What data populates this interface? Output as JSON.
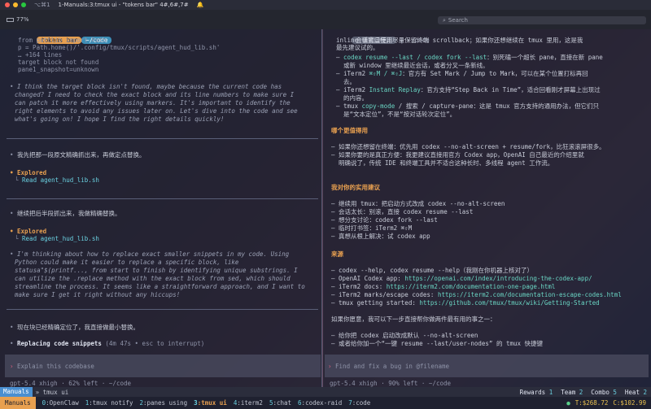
{
  "window": {
    "title": "1-Manuals:3:tmux ui - \"tokens bar\" 4#,6#,7#",
    "shortcut": "⌥⌘1"
  },
  "toolbar": {
    "battery": "77%",
    "search_placeholder": "Search"
  },
  "left": {
    "tab_label": "tokens bar",
    "path_label": "~/code",
    "code": [
      "from pathlib import Path",
      "p = Path.home()/'.config/tmux/scripts/agent_hud_lib.sh'",
      "… +164 lines",
      "target block not found",
      "pane1_snapshot=unknown"
    ],
    "thought1": [
      "I think the target block isn't found, maybe because the current code has",
      "changed? I need to check the exact block and its line numbers to make sure I",
      "can patch it more effectively using markers. It's important to identify the",
      "right elements to avoid any issues later on. Let's dive into the code and see",
      "what's going on! I hope I find the right details quickly!"
    ],
    "msg1": "我先把那一段原文精确抓出来，再做定点替换。",
    "explored1": "Explored",
    "read1": "Read agent_hud_lib.sh",
    "msg2": "继续把后半段抓出来，我做精确替换。",
    "explored2": "Explored",
    "read2": "Read agent_hud_lib.sh",
    "thought2": [
      "I'm thinking about how to replace exact smaller snippets in my code. Using",
      "Python could make it easier to replace a specific block, like",
      "statusa\"$(printf..., from start to finish by identifying unique substrings. I",
      "can utilize the .replace method with the exact block from sed, which should",
      "streamline the process. It seems like a straightforward approach, and I want to",
      "make sure I get it right without any hiccups!"
    ],
    "msg3": "现在块已经精确定位了，我直接做最小替换。",
    "working_label": "Replacing code snippets",
    "working_meta": "(4m 47s • esc to interrupt)",
    "input_placeholder": "Explain this codebase",
    "model_status": "gpt-5.4 xhigh · 62% left · ~/code"
  },
  "right": {
    "tab_label": "会话窗口使用",
    "path_label": "~/code",
    "top_lines": [
      "inline 模式运行，尽量保留终端 scrollback；如果你还想继续在 tmux 里用，这是我",
      "最先建议试的。"
    ],
    "items_a": [
      {
        "pre": "– ",
        "hl": "codex resume --last / codex fork --last",
        "post": "：别死磕一个超长 pane，直接在新 pane"
      },
      {
        "pre": "  或新 window 里继续最近会话，或者分叉一条新线。",
        "hl": "",
        "post": ""
      },
      {
        "pre": "– iTerm2 ",
        "hl": "⌘⇧M / ⌘⇧J",
        "post": "：官方有 Set Mark / Jump to Mark，可以在某个位置打标再回"
      },
      {
        "pre": "  去。",
        "hl": "",
        "post": ""
      },
      {
        "pre": "– iTerm2 ",
        "hl": "Instant Replay",
        "post": "：官方支持“Step Back in Time”，适合回看刚才屏幕上出现过"
      },
      {
        "pre": "  的内容。",
        "hl": "",
        "post": ""
      },
      {
        "pre": "– tmux ",
        "hl": "copy-mode",
        "post": " / 搜索 / capture-pane：这是 tmux 官方支持的通用办法，但它们只"
      },
      {
        "pre": "  是“文本定位”，不是“按对话轮次定位”。",
        "hl": "",
        "post": ""
      }
    ],
    "h_which": "哪个更值得用",
    "which": [
      "– 如果你还想留在终端：优先用 codex --no-alt-screen + resume/fork，比狂滚滚屏很多。",
      "– 如果你要的是真正方便：我更建议直接用官方 Codex app，OpenAI 自己最近的介绍里就",
      "  明确说了，传统 IDE 和终端工具并不适合这种长时、多线程 agent 工作流。"
    ],
    "h_advice": "我对你的实用建议",
    "advice": [
      "– 继续用 tmux：把启动方式改成 codex --no-alt-screen",
      "– 会话太长：别滚，直接 codex resume --last",
      "– 想分支讨论：codex fork --last",
      "– 临时打书签：iTerm2 ⌘⇧M",
      "– 真想从根上解决：试 codex app"
    ],
    "h_sources": "来源",
    "sources": [
      {
        "text": "– codex --help, codex resume --help（我刚在你机器上核对了）",
        "link": ""
      },
      {
        "text": "– OpenAI Codex app: ",
        "link": "https://openai.com/index/introducing-the-codex-app/"
      },
      {
        "text": "– iTerm2 docs: ",
        "link": "https://iterm2.com/documentation-one-page.html"
      },
      {
        "text": "– iTerm2 marks/escape codes: ",
        "link": "https://iterm2.com/documentation-escape-codes.html"
      },
      {
        "text": "– tmux getting started: ",
        "link": "https://github.com/tmux/tmux/wiki/Getting-Started"
      }
    ],
    "closing": "如果你愿意，我可以下一步直接帮你做两件最有用的事之一：",
    "options": [
      "– 给你把 codex 启动改成默认 --no-alt-screen",
      "– 或者给你加一个“一键 resume --last/user-nodes” 的 tmux 快捷键"
    ],
    "input_placeholder": "Find and fix a bug in @filename",
    "model_status": "gpt-5.4 xhigh · 90% left · ~/code"
  },
  "tmux1": {
    "session": "Manuals",
    "window": "tmux ui",
    "rewards_label": "Rewards",
    "rewards": "1",
    "team_label": "Team",
    "team": "2",
    "combo_label": "Combo",
    "combo": "5",
    "heat_label": "Heat",
    "heat": "2"
  },
  "tmux2": {
    "session": "Manuals",
    "windows": [
      {
        "idx": "0",
        "name": "OpenClaw",
        "active": false
      },
      {
        "idx": "1",
        "name": "tmux notify",
        "active": false
      },
      {
        "idx": "2",
        "name": "panes using",
        "active": false
      },
      {
        "idx": "3",
        "name": "tmux ui",
        "active": true
      },
      {
        "idx": "4",
        "name": "iterm2",
        "active": false
      },
      {
        "idx": "5",
        "name": "chat",
        "active": false
      },
      {
        "idx": "6",
        "name": "codex-raid",
        "active": false
      },
      {
        "idx": "7",
        "name": "code",
        "active": false
      }
    ],
    "tokens": "T:$268.72",
    "cost": "C:$102.99"
  },
  "colors": {
    "accent_orange": "#e8a050",
    "accent_cyan": "#6ad0e0",
    "accent_teal": "#6ad6c4",
    "prompt_pink": "#e06080",
    "status_green": "#5ad08a"
  }
}
